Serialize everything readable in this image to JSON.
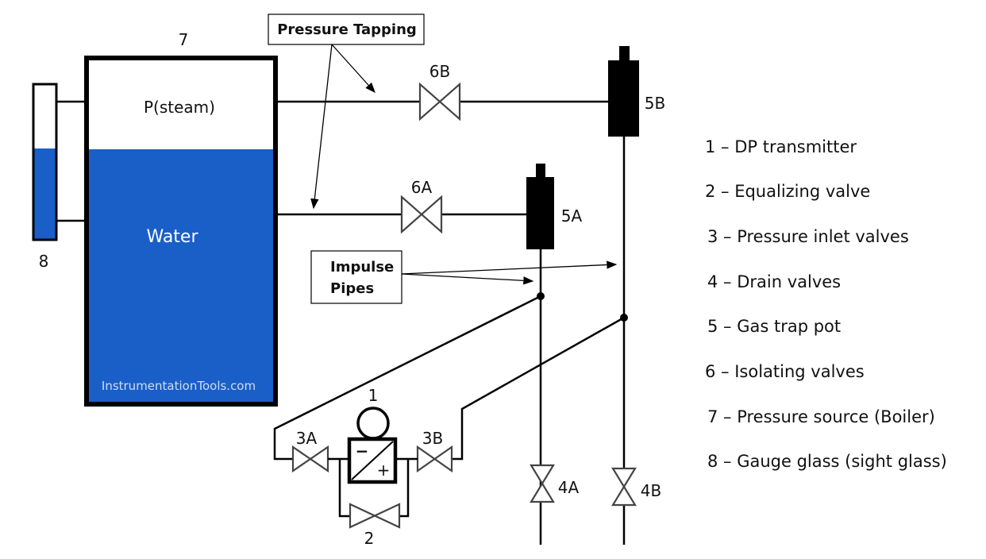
{
  "labels": {
    "boiler_number": "7",
    "steam": "P(steam)",
    "water": "Water",
    "gauge_number": "8",
    "watermark": "InstrumentationTools.com",
    "valve_6b": "6B",
    "valve_6a": "6A",
    "pot_5b": "5B",
    "pot_5a": "5A",
    "valve_4a": "4A",
    "valve_4b": "4B",
    "valve_3a": "3A",
    "valve_3b": "3B",
    "transmitter": "1",
    "equalizing": "2",
    "dp_minus": "−",
    "dp_plus": "+"
  },
  "callouts": {
    "pressure_tapping": "Pressure Tapping",
    "impulse_line1": "Impulse",
    "impulse_line2": "Pipes"
  },
  "legend": [
    "1 – DP transmitter",
    "2 – Equalizing valve",
    "3 – Pressure inlet valves",
    "4 – Drain valves",
    "5 – Gas trap pot",
    "6 – Isolating valves",
    "7 – Pressure source (Boiler)",
    "8 – Gauge glass (sight glass)"
  ],
  "colors": {
    "water": "#1a5fc8",
    "line": "#000000",
    "valve_outline": "#444444"
  }
}
